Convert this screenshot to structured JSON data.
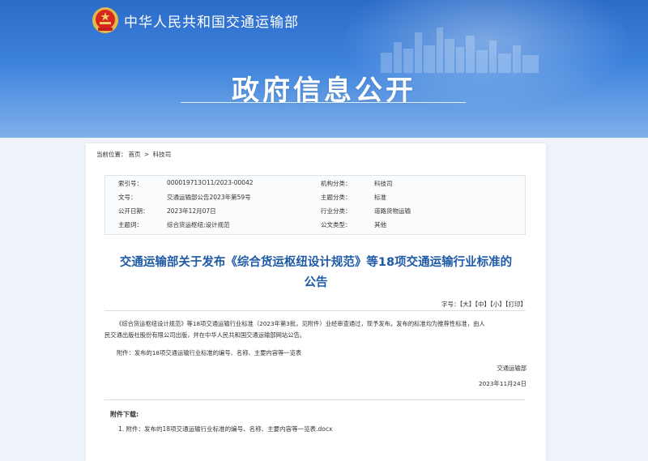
{
  "header": {
    "ministry_name": "中华人民共和国交通运输部",
    "section_title": "政府信息公开"
  },
  "breadcrumb": {
    "label": "当前位置：",
    "home": "首页",
    "separator": ">",
    "current": "科技司"
  },
  "meta": {
    "index_label": "索引号：",
    "index_value": "000019713O11/2023-00042",
    "org_label": "机构分类：",
    "org_value": "科技司",
    "docno_label": "文号：",
    "docno_value": "交通运输部公告2023年第59号",
    "topic_label": "主题分类：",
    "topic_value": "标准",
    "date_label": "公开日期：",
    "date_value": "2023年12月07日",
    "industry_label": "行业分类：",
    "industry_value": "道路货物运输",
    "keywords_label": "主题词：",
    "keywords_value": "综合货运枢纽;设计规范",
    "doctype_label": "公文类型：",
    "doctype_value": "其他"
  },
  "document": {
    "title_line1": "交通运输部关于发布《综合货运枢纽设计规范》等18项交通运输行业标准的",
    "title_line2": "公告",
    "font_label": "字号：",
    "font_large": "【大】",
    "font_medium": "【中】",
    "font_small": "【小】",
    "print": "【打印】",
    "paragraph_line1": "《综合货运枢纽设计规范》等18项交通运输行业标准（2023年第3批，见附件）业经审查通过，现予发布。发布的标准均为推荐性标准，由人",
    "paragraph_line2": "民交通出版社股份有限公司出版，并在中华人民共和国交通运输部网站公告。",
    "attachment_note": "附件：发布的18项交通运输行业标准的编号、名称、主要内容等一览表",
    "signature": "交通运输部",
    "sign_date": "2023年11月24日"
  },
  "downloads": {
    "heading": "附件下载:",
    "items": [
      {
        "label": "1. 附件：发布的18项交通运输行业标准的编号、名称、主要内容等一览表.docx"
      }
    ]
  },
  "colors": {
    "banner": "#3d82dc",
    "title_blue": "#1e5aa6"
  }
}
